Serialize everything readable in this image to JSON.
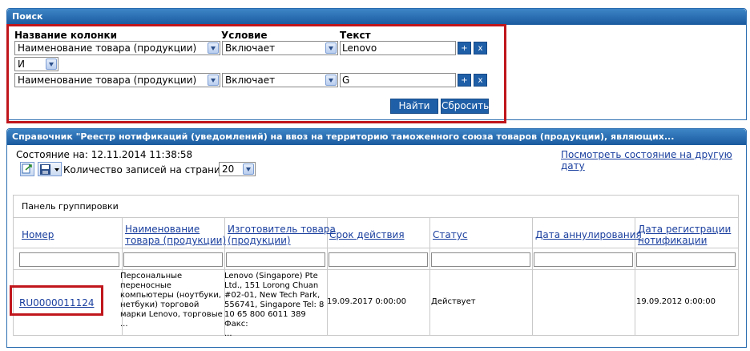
{
  "search": {
    "title": "Поиск",
    "col_name_label": "Название колонки",
    "condition_label": "Условие",
    "text_label": "Текст",
    "rows": [
      {
        "column": "Наименование товара (продукции)",
        "condition": "Включает",
        "text": "Lenovo"
      },
      {
        "column": "Наименование товара (продукции)",
        "condition": "Включает",
        "text": "G"
      }
    ],
    "logic": "И",
    "add_label": "+",
    "remove_label": "x",
    "find_label": "Найти",
    "reset_label": "Сбросить"
  },
  "reference": {
    "title": "Справочник \"Реестр нотификаций (уведомлений) на ввоз на территорию таможенного союза товаров (продукции), являющих...",
    "state_label": "Состояние на: 12.11.2014 11:38:58",
    "other_date_link": "Посмотреть состояние на другую дату",
    "records_per_page_label": "Количество записей на странице",
    "page_size": "20",
    "group_panel_label": "Панель группировки",
    "columns": {
      "number": "Номер",
      "name_l1": "Наименование",
      "name_l2": "товара (продукции)",
      "maker_l1": "Изготовитель товара",
      "maker_l2": "(продукции)",
      "validity": "Срок действия",
      "status": "Статус",
      "annul": "Дата аннулирования",
      "reg_l1": "Дата регистрации",
      "reg_l2": "нотификации"
    },
    "row": {
      "number": "RU0000011124",
      "name_lines": [
        "Персональные",
        "переносные",
        "компьютеры (ноутбуки,",
        "нетбуки) торговой",
        "марки Lenovo, торговые",
        "..."
      ],
      "maker_lines": [
        "Lenovo (Singapore) Pte",
        "Ltd., 151 Lorong Chuan",
        "#02-01, New Tech Park,",
        "556741, Singapore Tel: 8",
        "10 65 800 6011 389 Факс:",
        "..."
      ],
      "validity": "19.09.2017 0:00:00",
      "status": "Действует",
      "annul": "",
      "reg": "19.09.2012 0:00:00"
    }
  }
}
